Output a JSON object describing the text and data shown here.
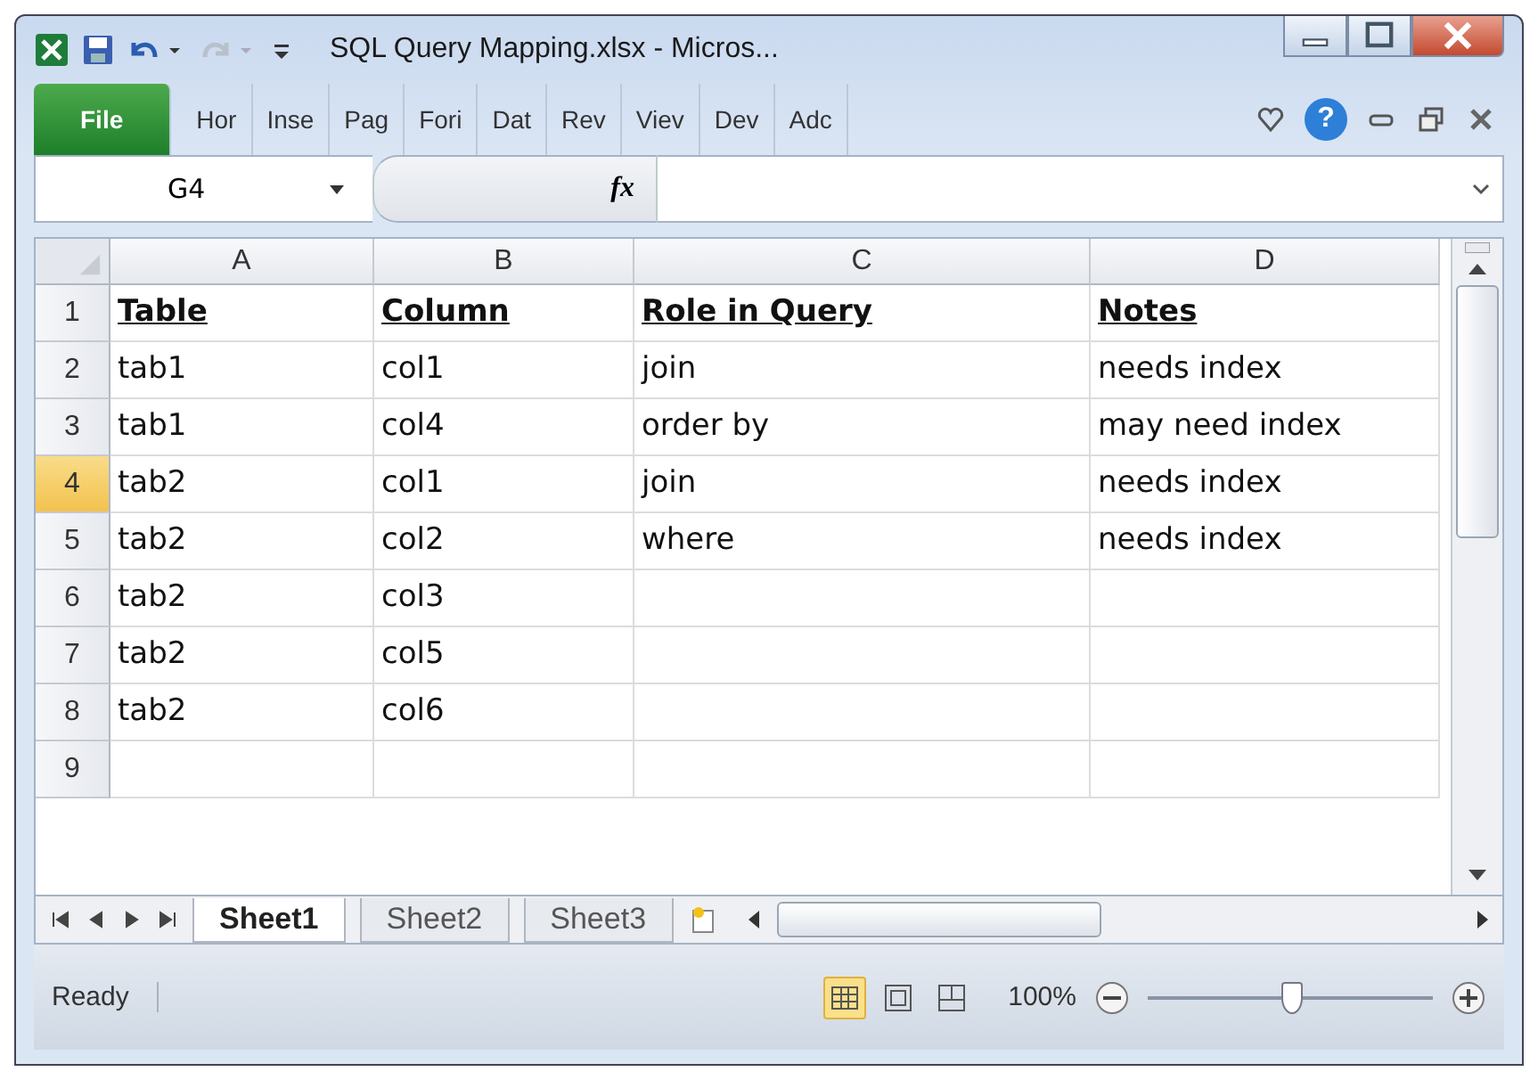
{
  "window": {
    "title": "SQL Query Mapping.xlsx  -  Micros..."
  },
  "ribbon_tabs": [
    {
      "label": "File",
      "kind": "file",
      "selected": false
    },
    {
      "label": "Hor",
      "kind": "tab",
      "selected": false
    },
    {
      "label": "Inse",
      "kind": "tab",
      "selected": false
    },
    {
      "label": "Pag",
      "kind": "tab",
      "selected": false
    },
    {
      "label": "Fori",
      "kind": "tab",
      "selected": false
    },
    {
      "label": "Dat",
      "kind": "tab",
      "selected": false
    },
    {
      "label": "Rev",
      "kind": "tab",
      "selected": false
    },
    {
      "label": "Viev",
      "kind": "tab",
      "selected": false
    },
    {
      "label": "Dev",
      "kind": "tab",
      "selected": false
    },
    {
      "label": "Adc",
      "kind": "tab",
      "selected": false
    }
  ],
  "help": "?",
  "formula_bar": {
    "name_box": "G4",
    "fx": "fx"
  },
  "sheet": {
    "columns": [
      "A",
      "B",
      "C",
      "D"
    ],
    "rows": [
      {
        "number": "1",
        "selected": false,
        "cells": [
          "Table",
          "Column",
          "Role in Query",
          "Notes"
        ],
        "kind": "header"
      },
      {
        "number": "2",
        "selected": false,
        "cells": [
          "tab1",
          "col1",
          "join",
          "needs index"
        ],
        "kind": "data"
      },
      {
        "number": "3",
        "selected": false,
        "cells": [
          "tab1",
          "col4",
          "order by",
          "may need index"
        ],
        "kind": "data"
      },
      {
        "number": "4",
        "selected": true,
        "cells": [
          "tab2",
          "col1",
          "join",
          "needs index"
        ],
        "kind": "data"
      },
      {
        "number": "5",
        "selected": false,
        "cells": [
          "tab2",
          "col2",
          "where",
          "needs index"
        ],
        "kind": "data"
      },
      {
        "number": "6",
        "selected": false,
        "cells": [
          "tab2",
          "col3",
          null,
          null
        ],
        "kind": "data"
      },
      {
        "number": "7",
        "selected": false,
        "cells": [
          "tab2",
          "col5",
          null,
          null
        ],
        "kind": "data"
      },
      {
        "number": "8",
        "selected": false,
        "cells": [
          "tab2",
          "col6",
          null,
          null
        ],
        "kind": "data"
      },
      {
        "number": "9",
        "selected": false,
        "cells": [
          null,
          null,
          null,
          null
        ],
        "kind": "data"
      }
    ]
  },
  "sheet_tabs": [
    {
      "label": "Sheet1",
      "selected": true
    },
    {
      "label": "Sheet2",
      "selected": false
    },
    {
      "label": "Sheet3",
      "selected": false
    }
  ],
  "status_bar": {
    "status": "Ready",
    "views": [
      {
        "kind": "normal",
        "selected": true
      },
      {
        "kind": "layout",
        "selected": false
      },
      {
        "kind": "pagebreak",
        "selected": false
      }
    ],
    "zoom": "100%",
    "zoom_slider": {
      "level": 0.5
    }
  }
}
